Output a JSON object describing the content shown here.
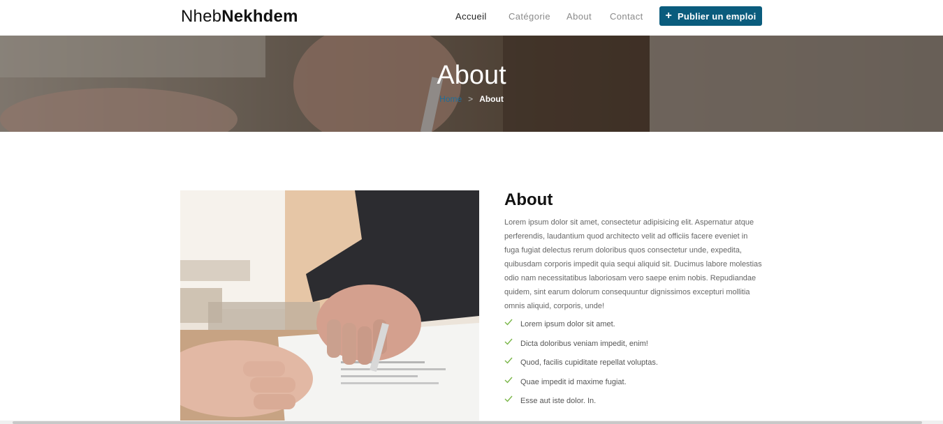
{
  "navbar": {
    "brand_light": "Nheb",
    "brand_bold": "Nekhdem",
    "links": [
      {
        "label": "Accueil"
      },
      {
        "label": "Catégorie"
      },
      {
        "label": "About"
      },
      {
        "label": "Contact"
      }
    ],
    "active_link": "Accueil",
    "post_button": {
      "icon": "plus-icon",
      "label": "Publier un emploi"
    }
  },
  "hero": {
    "title": "About",
    "breadcrumb": {
      "home": "Home",
      "separator": ">",
      "current": "About"
    }
  },
  "about": {
    "heading": "About",
    "paragraph": "Lorem ipsum dolor sit amet, consectetur adipisicing elit. Aspernatur atque perferendis, laudantium quod architecto velit ad officiis facere eveniet in fuga fugiat delectus rerum doloribus quos consectetur unde, expedita, quibusdam corporis impedit quia sequi aliquid sit. Ducimus labore molestias odio nam necessitatibus laboriosam vero saepe enim nobis. Repudiandae quidem, sint earum dolorum consequuntur dignissimos excepturi mollitia omnis aliquid, corporis, unde!",
    "checklist": [
      "Lorem ipsum dolor sit amet.",
      "Dicta doloribus veniam impedit, enim!",
      "Quod, facilis cupiditate repellat voluptas.",
      "Quae impedit id maxime fugiat.",
      "Esse aut iste dolor. In."
    ],
    "check_icon": "check-icon"
  },
  "colors": {
    "accent": "#0a5c7d",
    "check": "#7ab648",
    "breadcrumb_home": "#1e6e9a"
  }
}
